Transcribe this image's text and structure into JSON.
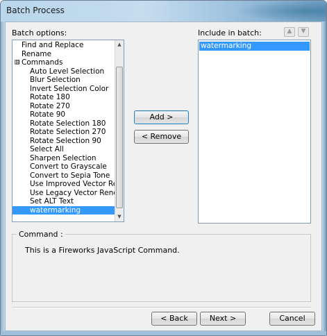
{
  "window": {
    "title": "Batch Process"
  },
  "batch_options": {
    "label": "Batch options:",
    "items": [
      {
        "label": "Find and Replace",
        "indent": 0,
        "selected": false
      },
      {
        "label": "Rename",
        "indent": 0,
        "selected": false
      },
      {
        "label": "Commands",
        "indent": 0,
        "selected": false,
        "expander": "⊟"
      },
      {
        "label": "Auto Level Selection",
        "indent": 1,
        "selected": false
      },
      {
        "label": "Blur Selection",
        "indent": 1,
        "selected": false
      },
      {
        "label": "Invert Selection Color",
        "indent": 1,
        "selected": false
      },
      {
        "label": "Rotate 180",
        "indent": 1,
        "selected": false
      },
      {
        "label": "Rotate 270",
        "indent": 1,
        "selected": false
      },
      {
        "label": "Rotate 90",
        "indent": 1,
        "selected": false
      },
      {
        "label": "Rotate Selection 180",
        "indent": 1,
        "selected": false
      },
      {
        "label": "Rotate Selection 270",
        "indent": 1,
        "selected": false
      },
      {
        "label": "Rotate Selection 90",
        "indent": 1,
        "selected": false
      },
      {
        "label": "Select All",
        "indent": 1,
        "selected": false
      },
      {
        "label": "Sharpen Selection",
        "indent": 1,
        "selected": false
      },
      {
        "label": "Convert to Grayscale",
        "indent": 1,
        "selected": false
      },
      {
        "label": "Convert to Sepia Tone",
        "indent": 1,
        "selected": false
      },
      {
        "label": "Use Improved Vector Rende",
        "indent": 1,
        "selected": false
      },
      {
        "label": "Use Legacy Vector Renderin",
        "indent": 1,
        "selected": false
      },
      {
        "label": "Set ALT Text",
        "indent": 1,
        "selected": false
      },
      {
        "label": "watermarking",
        "indent": 1,
        "selected": true
      }
    ]
  },
  "include_in_batch": {
    "label": "Include in batch:",
    "items": [
      {
        "label": "watermarking",
        "selected": true
      }
    ]
  },
  "buttons": {
    "add": "Add >",
    "remove": "< Remove",
    "back": "< Back",
    "next": "Next >",
    "cancel": "Cancel",
    "move_up": "▲",
    "move_down": "▼"
  },
  "command_group": {
    "title": "Command :",
    "description": "This is a Fireworks JavaScript Command."
  },
  "colors": {
    "selection": "#3399ff",
    "dialog_bg": "#f0f0f0"
  }
}
